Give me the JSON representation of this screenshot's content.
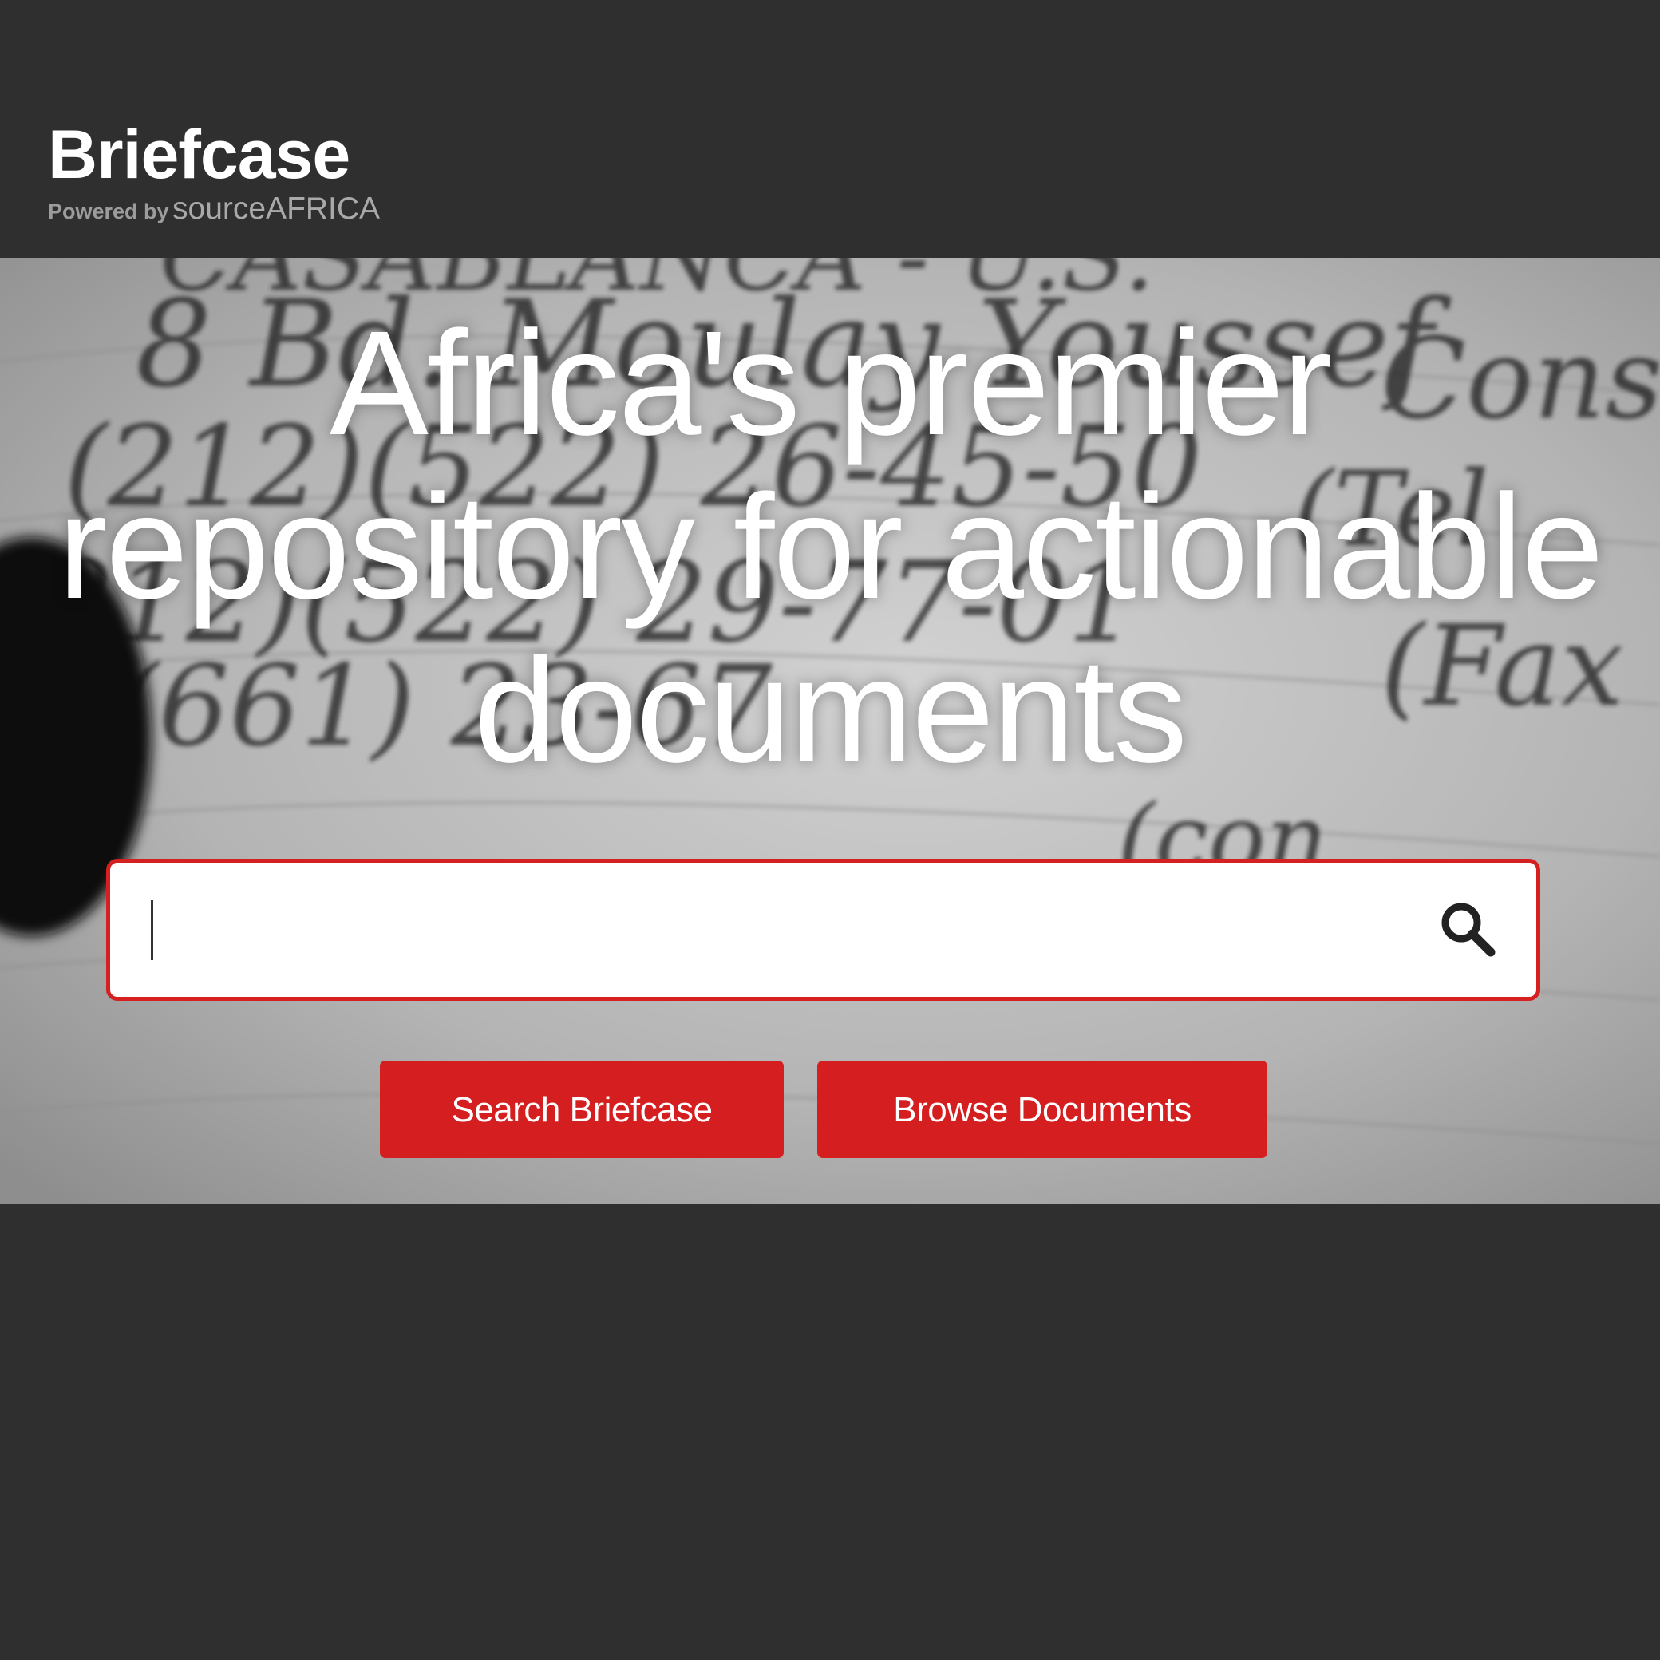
{
  "brand": {
    "title": "Briefcase",
    "powered_by": "Powered by",
    "source": "sourceAFRICA"
  },
  "hero": {
    "headline": "Africa's premier repository for actionable documents",
    "background_image": "grayscale photo of handwritten phone numbers on lined notepaper"
  },
  "search": {
    "value": "",
    "placeholder": "",
    "icon": "search-icon"
  },
  "buttons": {
    "search_label": "Search Briefcase",
    "browse_label": "Browse Documents"
  },
  "colors": {
    "background": "#2f2f30",
    "accent": "#d41e1f",
    "brand_text": "#ffffff",
    "brand_sub": "#9c9c9c"
  }
}
